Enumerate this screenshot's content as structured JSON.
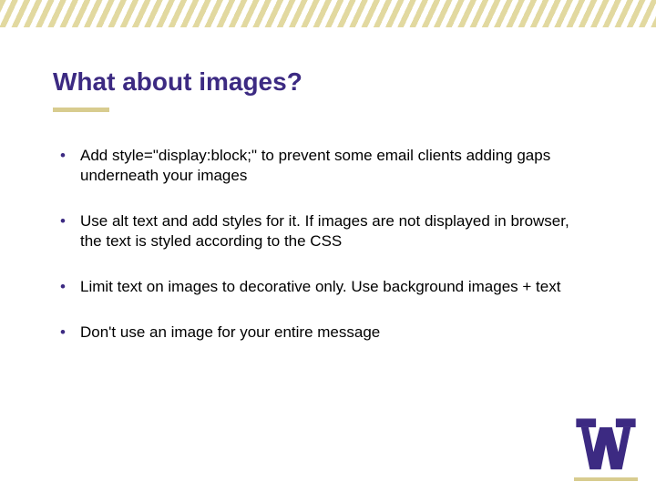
{
  "title": "What about images?",
  "bullets": [
    "Add style=\"display:block;\" to prevent some email clients adding gaps underneath your images",
    "Use alt text and add styles for it. If images are not displayed in browser, the text is styled according to the CSS",
    "Limit text on images to decorative only. Use background images + text",
    "Don't use an image for your entire message"
  ],
  "brand_color": "#3c2a82",
  "accent_color": "#d8cc8f"
}
